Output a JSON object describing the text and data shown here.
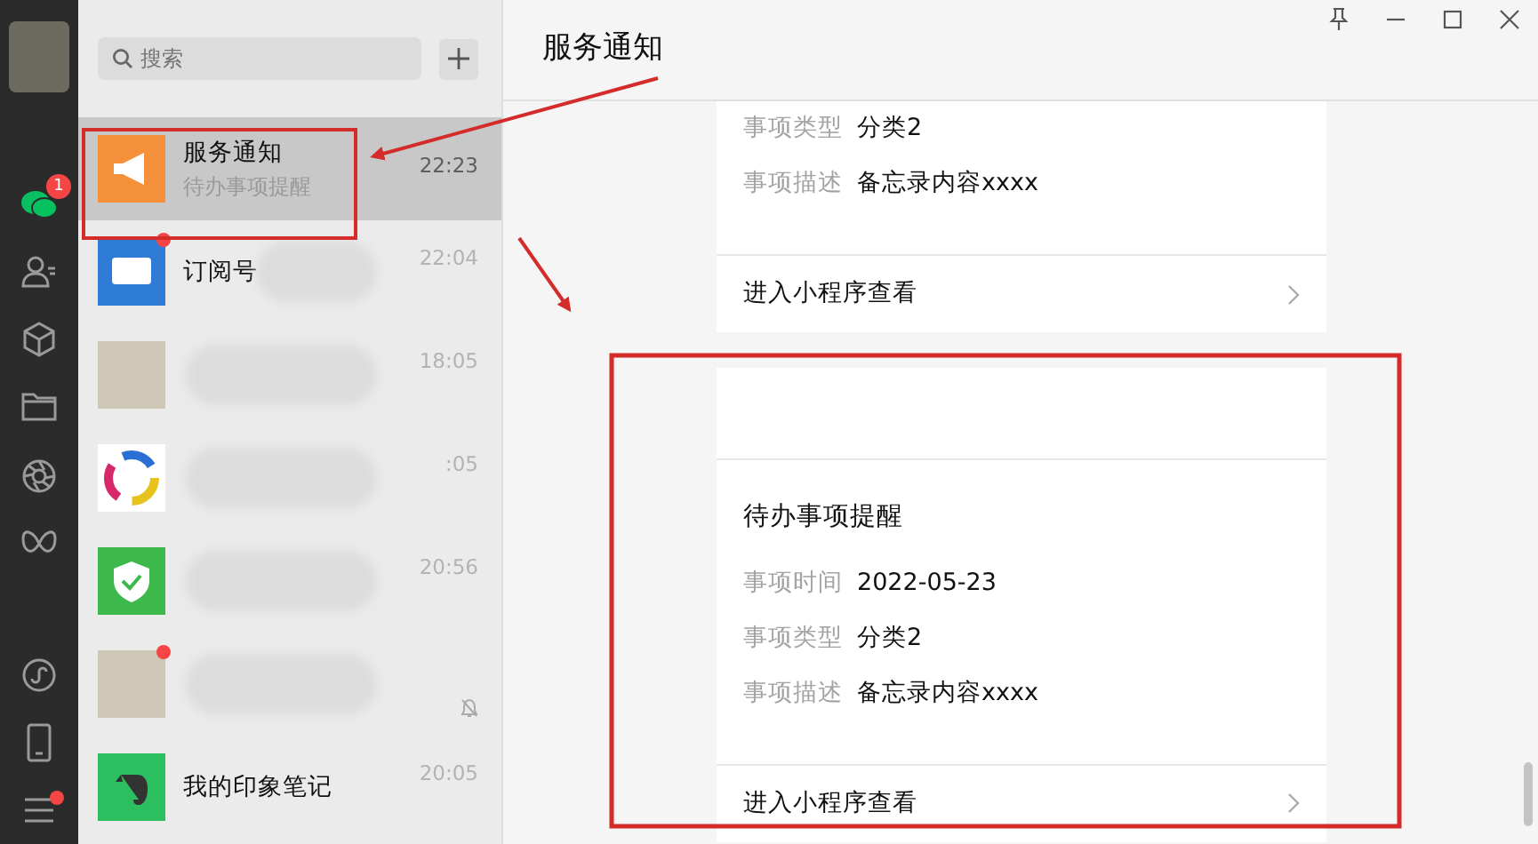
{
  "sidebar": {
    "items": [
      {
        "kind": "chats",
        "selected": true,
        "badge": "1"
      },
      {
        "kind": "contacts",
        "selected": false
      },
      {
        "kind": "favorites",
        "selected": false
      },
      {
        "kind": "files",
        "selected": false
      },
      {
        "kind": "moments",
        "selected": false
      },
      {
        "kind": "channels",
        "selected": false
      },
      {
        "kind": "miniprograms",
        "selected": false
      },
      {
        "kind": "phone",
        "selected": false
      },
      {
        "kind": "menu",
        "selected": false,
        "dot": true
      }
    ]
  },
  "chat_list": {
    "search": {
      "placeholder": "搜索"
    },
    "conversations": [
      {
        "kind": "megaphone",
        "name": "服务通知",
        "preview": "待办事项提醒",
        "time": "22:23",
        "selected": true,
        "dot": false,
        "blurred": false,
        "muted": false
      },
      {
        "kind": "screen",
        "name": "订阅号",
        "time": "22:04",
        "selected": false,
        "dot": true,
        "blurred": true,
        "muted": false
      },
      {
        "kind": "photo",
        "time": "18:05",
        "selected": false,
        "dot": false,
        "blurred": true,
        "muted": false
      },
      {
        "kind": "rings",
        "time": ":05",
        "selected": false,
        "dot": false,
        "blurred": true,
        "muted": false
      },
      {
        "kind": "shield",
        "time": "20:56",
        "selected": false,
        "dot": false,
        "blurred": true,
        "muted": false
      },
      {
        "kind": "photo",
        "selected": false,
        "dot": true,
        "blurred": true,
        "muted": true
      },
      {
        "kind": "note",
        "name": "我的印象笔记",
        "time": "20:05",
        "selected": false,
        "dot": false,
        "blurred": false,
        "muted": false
      }
    ]
  },
  "main": {
    "title": "服务通知",
    "messages": [
      {
        "top_cut": true,
        "fields": [
          {
            "label": "事项类型",
            "value": "分类2"
          },
          {
            "label": "事项描述",
            "value": "备忘录内容xxxx"
          }
        ],
        "link": "进入小程序查看"
      },
      {
        "top_cut": false,
        "title": "待办事项提醒",
        "fields": [
          {
            "label": "事项时间",
            "value": "2022-05-23"
          },
          {
            "label": "事项类型",
            "value": "分类2"
          },
          {
            "label": "事项描述",
            "value": "备忘录内容xxxx"
          }
        ],
        "link": "进入小程序查看"
      }
    ]
  }
}
